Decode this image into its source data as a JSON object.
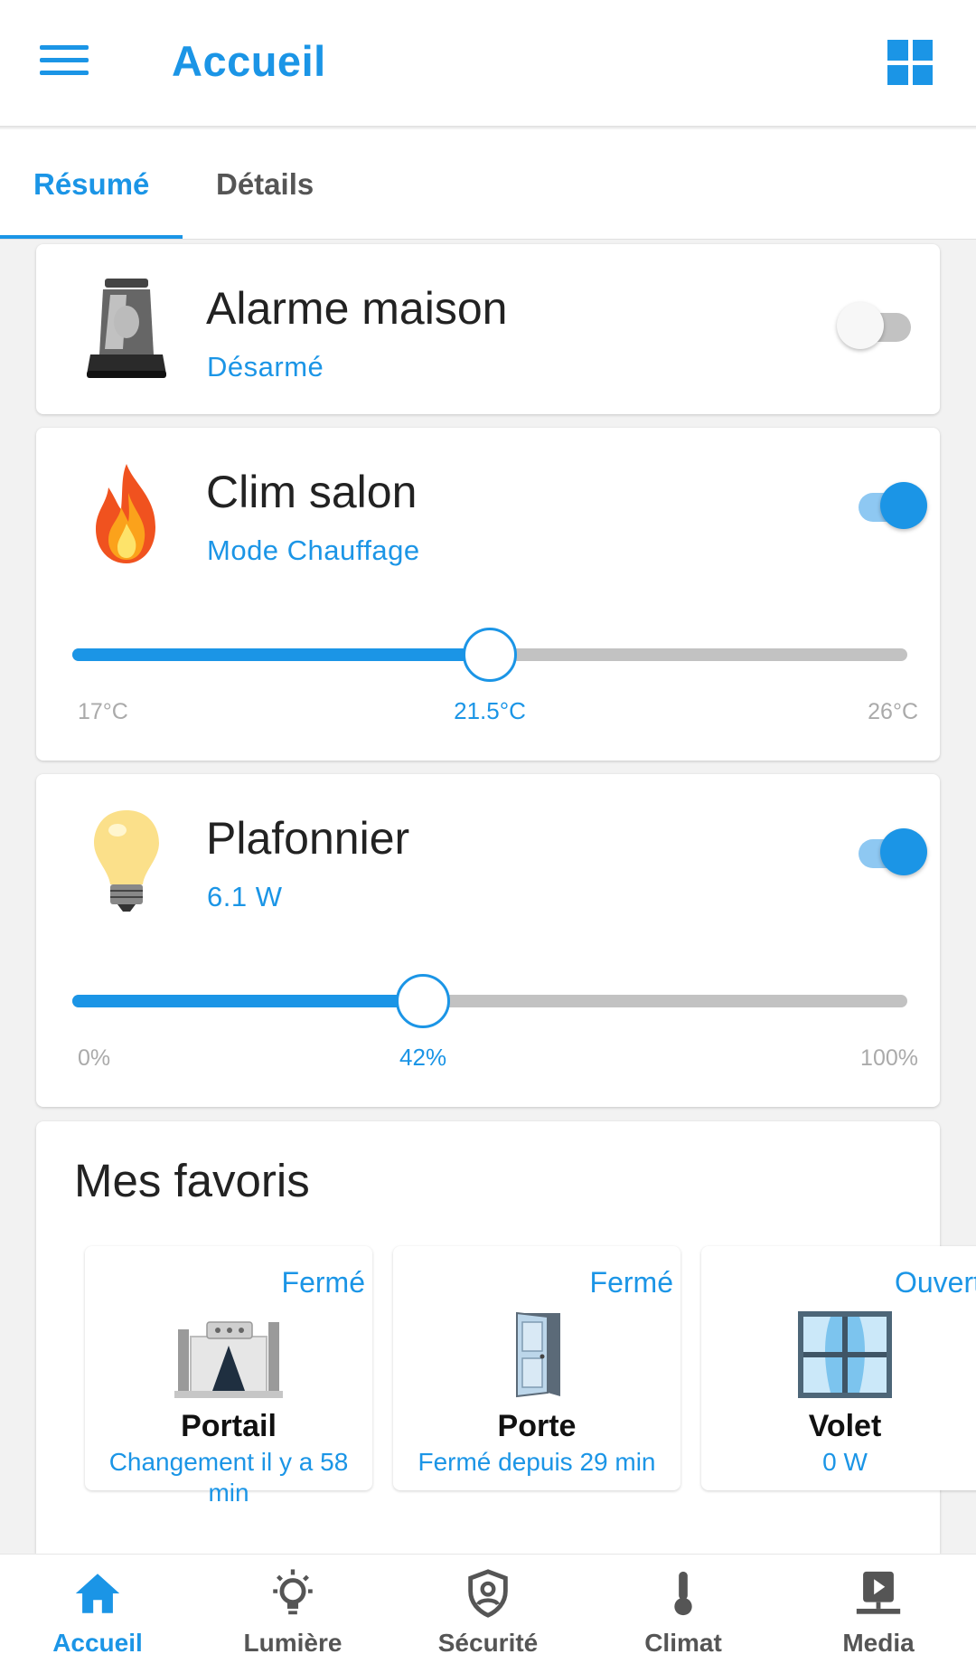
{
  "appbar": {
    "title": "Accueil",
    "menu_icon": "hamburger-menu-icon",
    "view_icon": "grid-view-icon",
    "accent": "#1b95e6"
  },
  "tabs": [
    {
      "label": "Résumé",
      "active": true
    },
    {
      "label": "Détails",
      "active": false
    }
  ],
  "alarm": {
    "title": "Alarme maison",
    "status": "Désarmé",
    "icon": "siren-icon",
    "enabled": false
  },
  "clim": {
    "title": "Clim salon",
    "status": "Mode Chauffage",
    "icon": "flame-icon",
    "enabled": true,
    "slider": {
      "min_label": "17°C",
      "max_label": "26°C",
      "value_label": "21.5°C",
      "min": 17,
      "max": 26,
      "value": 21.5
    }
  },
  "light": {
    "title": "Plafonnier",
    "status": "6.1 W",
    "icon": "light-bulb-icon",
    "enabled": true,
    "slider": {
      "min_label": "0%",
      "max_label": "100%",
      "value_label": "42%",
      "min": 0,
      "max": 100,
      "value": 42
    }
  },
  "favorites": {
    "title": "Mes favoris",
    "items": [
      {
        "state": "Fermé",
        "name": "Portail",
        "sub": "Changement il y a 58 min",
        "icon": "gate-icon"
      },
      {
        "state": "Fermé",
        "name": "Porte",
        "sub": "Fermé depuis 29 min",
        "icon": "door-icon"
      },
      {
        "state": "Ouvert",
        "name": "Volet",
        "sub": "0 W",
        "icon": "window-shutter-icon"
      }
    ]
  },
  "bottom_nav": [
    {
      "label": "Accueil",
      "icon": "home-icon",
      "active": true
    },
    {
      "label": "Lumière",
      "icon": "bulb-outline-icon",
      "active": false
    },
    {
      "label": "Sécurité",
      "icon": "shield-person-icon",
      "active": false
    },
    {
      "label": "Climat",
      "icon": "thermometer-icon",
      "active": false
    },
    {
      "label": "Media",
      "icon": "media-player-icon",
      "active": false
    }
  ]
}
